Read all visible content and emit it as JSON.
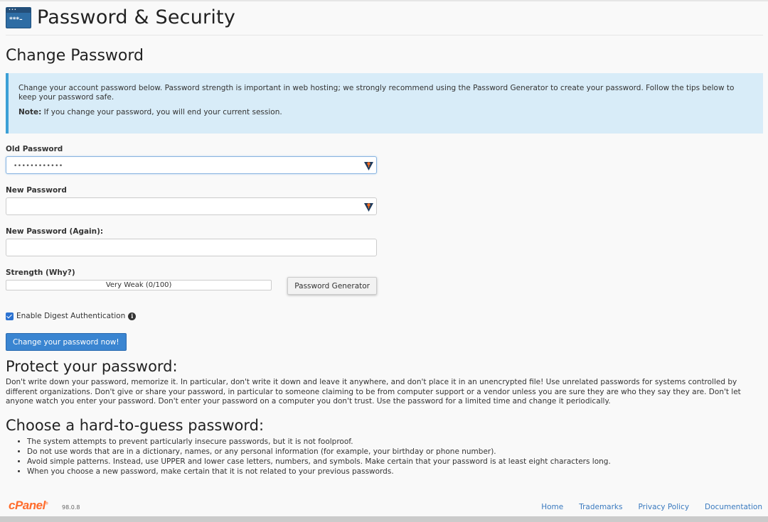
{
  "header": {
    "title": "Password & Security",
    "icon": "password-window-icon"
  },
  "section": {
    "title": "Change Password"
  },
  "alert": {
    "message": "Change your account password below. Password strength is important in web hosting; we strongly recommend using the Password Generator to create your password. Follow the tips below to keep your password safe.",
    "note_label": "Note:",
    "note_text": " If you change your password, you will end your current session."
  },
  "form": {
    "old_password": {
      "label": "Old Password",
      "value": "••••••••••••",
      "icon": "password-manager-icon"
    },
    "new_password": {
      "label": "New Password",
      "value": "",
      "icon": "password-manager-icon"
    },
    "new_password_again": {
      "label": "New Password (Again):",
      "value": ""
    },
    "strength": {
      "label": "Strength ",
      "why_link": "(Why?)",
      "text": "Very Weak (0/100)",
      "score": 0,
      "max": 100
    },
    "generator_button": "Password Generator",
    "digest": {
      "label": "Enable Digest Authentication",
      "checked": true,
      "icon": "info-icon"
    },
    "submit_button": "Change your password now!"
  },
  "protect": {
    "title": "Protect your password:",
    "text": "Don't write down your password, memorize it. In particular, don't write it down and leave it anywhere, and don't place it in an unencrypted file! Use unrelated passwords for systems controlled by different organizations. Don't give or share your password, in particular to someone claiming to be from computer support or a vendor unless you are sure they are who they say they are. Don't let anyone watch you enter your password. Don't enter your password on a computer you don't trust. Use the password for a limited time and change it periodically."
  },
  "choose": {
    "title": "Choose a hard-to-guess password:",
    "tips": [
      "The system attempts to prevent particularly insecure passwords, but it is not foolproof.",
      "Do not use words that are in a dictionary, names, or any personal information (for example, your birthday or phone number).",
      "Avoid simple patterns. Instead, use UPPER and lower case letters, numbers, and symbols. Make certain that your password is at least eight characters long.",
      "When you choose a new password, make certain that it is not related to your previous passwords."
    ]
  },
  "footer": {
    "logo": "cPanel",
    "version": "98.0.8",
    "links": [
      "Home",
      "Trademarks",
      "Privacy Policy",
      "Documentation"
    ]
  },
  "colors": {
    "accent": "#3a85d1",
    "logo": "#ff6c2c",
    "alert_bg": "#d8ecf8",
    "alert_border": "#3da0d6",
    "link": "#3a7abf"
  }
}
